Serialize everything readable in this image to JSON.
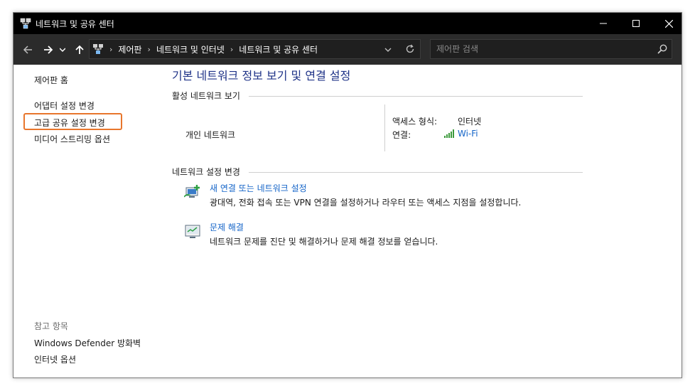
{
  "window": {
    "title": "네트워크 및 공유 센터"
  },
  "address_bar": {
    "breadcrumbs": [
      "제어판",
      "네트워크 및 인터넷",
      "네트워크 및 공유 센터"
    ],
    "search_placeholder": "제어판 검색"
  },
  "left_pane": {
    "home": "제어판 홈",
    "links": [
      "어댑터 설정 변경",
      "고급 공유 설정 변경",
      "미디어 스트리밍 옵션"
    ],
    "see_also_heading": "참고 항목",
    "see_also": [
      "Windows Defender 방화벽",
      "인터넷 옵션"
    ],
    "highlight_color": "#e8762c"
  },
  "main": {
    "title": "기본 네트워크 정보 보기 및 연결 설정",
    "active_section": "활성 네트워크 보기",
    "network_name": "개인 네트워크",
    "access_type_label": "액세스 형식:",
    "access_type_value": "인터넷",
    "connection_label": "연결:",
    "connection_value": "Wi-Fi",
    "change_section": "네트워크 설정 변경",
    "tasks": [
      {
        "title": "새 연결 또는 네트워크 설정",
        "description": "광대역, 전화 접속 또는 VPN 연결을 설정하거나 라우터 또는 액세스 지점을 설정합니다.",
        "icon": "new-connection-icon"
      },
      {
        "title": "문제 해결",
        "description": "네트워크 문제를 진단 및 해결하거나 문제 해결 정보를 얻습니다.",
        "icon": "troubleshoot-icon"
      }
    ]
  },
  "colors": {
    "title_blue": "#1e3287",
    "link_blue": "#1464c8"
  }
}
